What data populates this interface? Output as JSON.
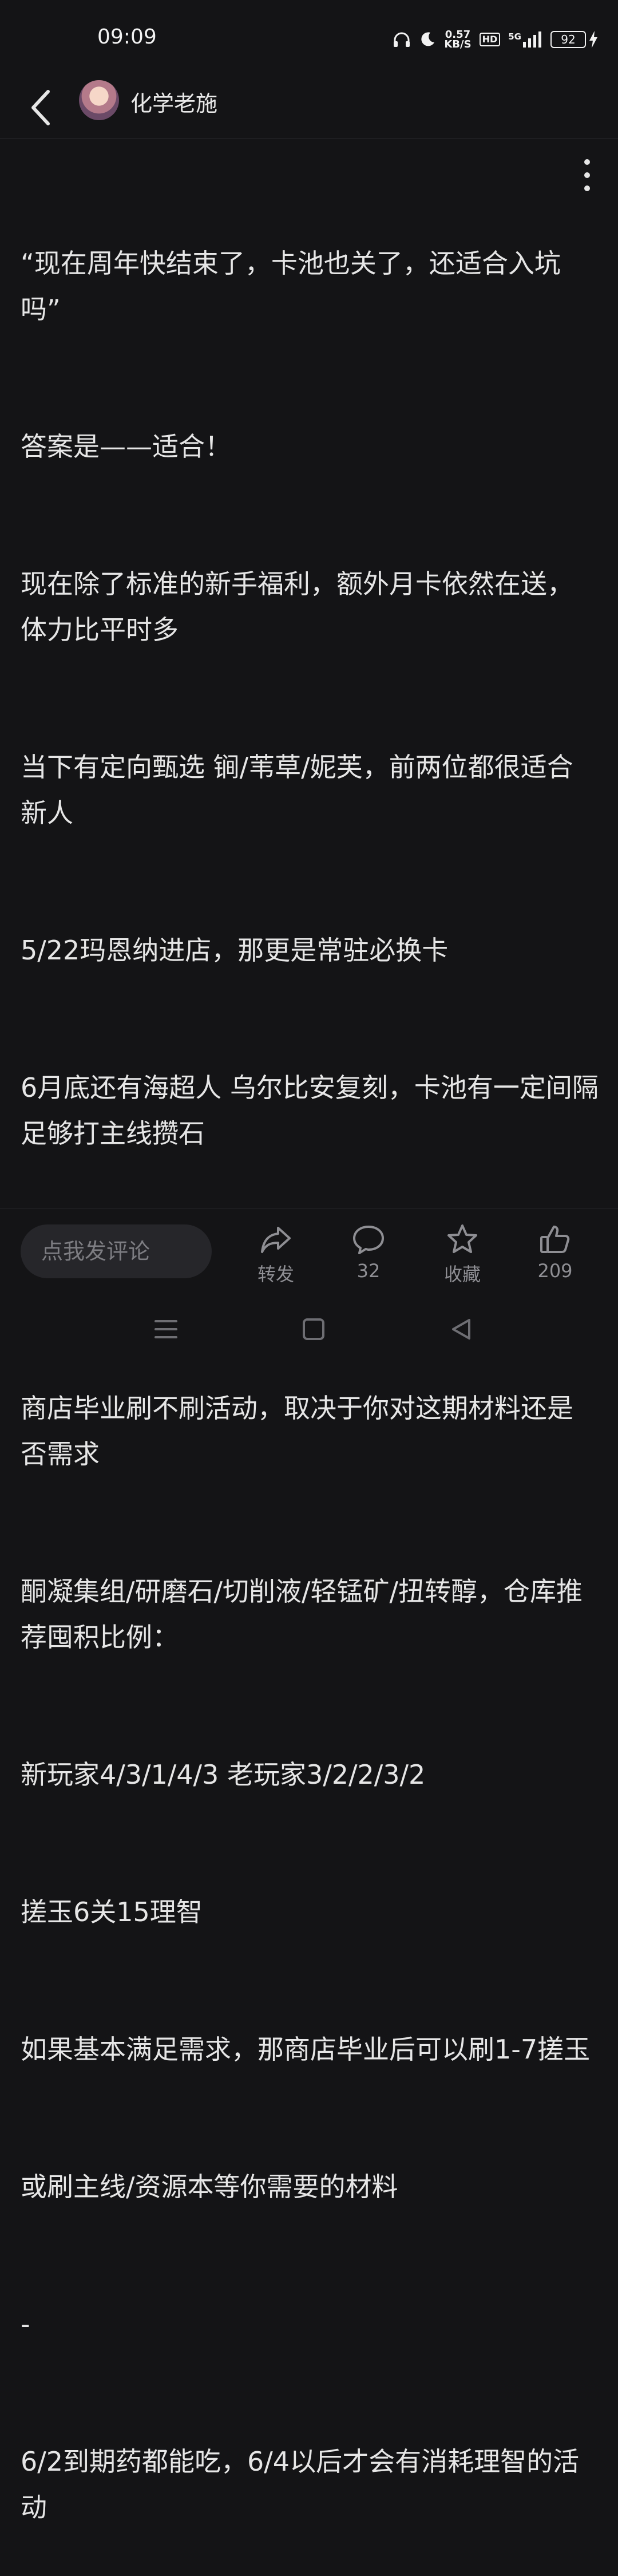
{
  "status": {
    "time": "09:09",
    "net_speed_value": "0.57",
    "net_speed_unit": "KB/S",
    "hd": "HD",
    "network": "5G",
    "battery": "92"
  },
  "header": {
    "author": "化学老施",
    "icons": [
      "back-icon",
      "avatar",
      "more-vert-icon"
    ]
  },
  "article": {
    "lines": [
      "“现在周年快结束了，卡池也关了，还适合入坑吗”",
      "答案是——适合！",
      "现在除了标准的新手福利，额外月卡依然在送，体力比平时多",
      "当下有定向甄选 锏/苇草/妮芙，前两位都很适合新人",
      "5/22玛恩纳进店，那更是常驻必换卡",
      "6月底还有海超人 乌尔比安复刻，卡池有一定间隔足够打主线攒石",
      "-",
      "商店毕业刷不刷活动，取决于你对这期材料还是否需求",
      "酮凝集组/研磨石/切削液/轻锰矿/扭转醇，仓库推荐囤积比例：",
      "新玩家4/3/1/4/3 老玩家3/2/2/3/2",
      "搓玉6关15理智",
      "如果基本满足需求，那商店毕业后可以刷1-7搓玉",
      "或刷主线/资源本等你需要的材料",
      "-",
      "6/2到期药都能吃，6/4以后才会有消耗理智的活动"
    ]
  },
  "bottom": {
    "comment_placeholder": "点我发评论",
    "share_label": "转发",
    "comment_count": "32",
    "favorite_label": "收藏",
    "like_count": "209"
  }
}
